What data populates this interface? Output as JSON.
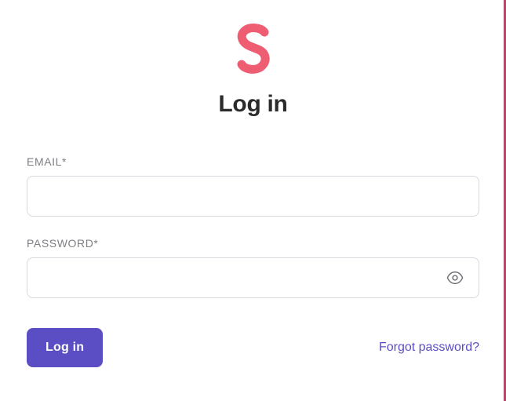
{
  "heading": "Log in",
  "email": {
    "label": "EMAIL*",
    "value": ""
  },
  "password": {
    "label": "PASSWORD*",
    "value": ""
  },
  "actions": {
    "login_label": "Log in",
    "forgot_label": "Forgot password?"
  },
  "colors": {
    "accent": "#5b4dc4",
    "logo": "#ee5d72"
  }
}
